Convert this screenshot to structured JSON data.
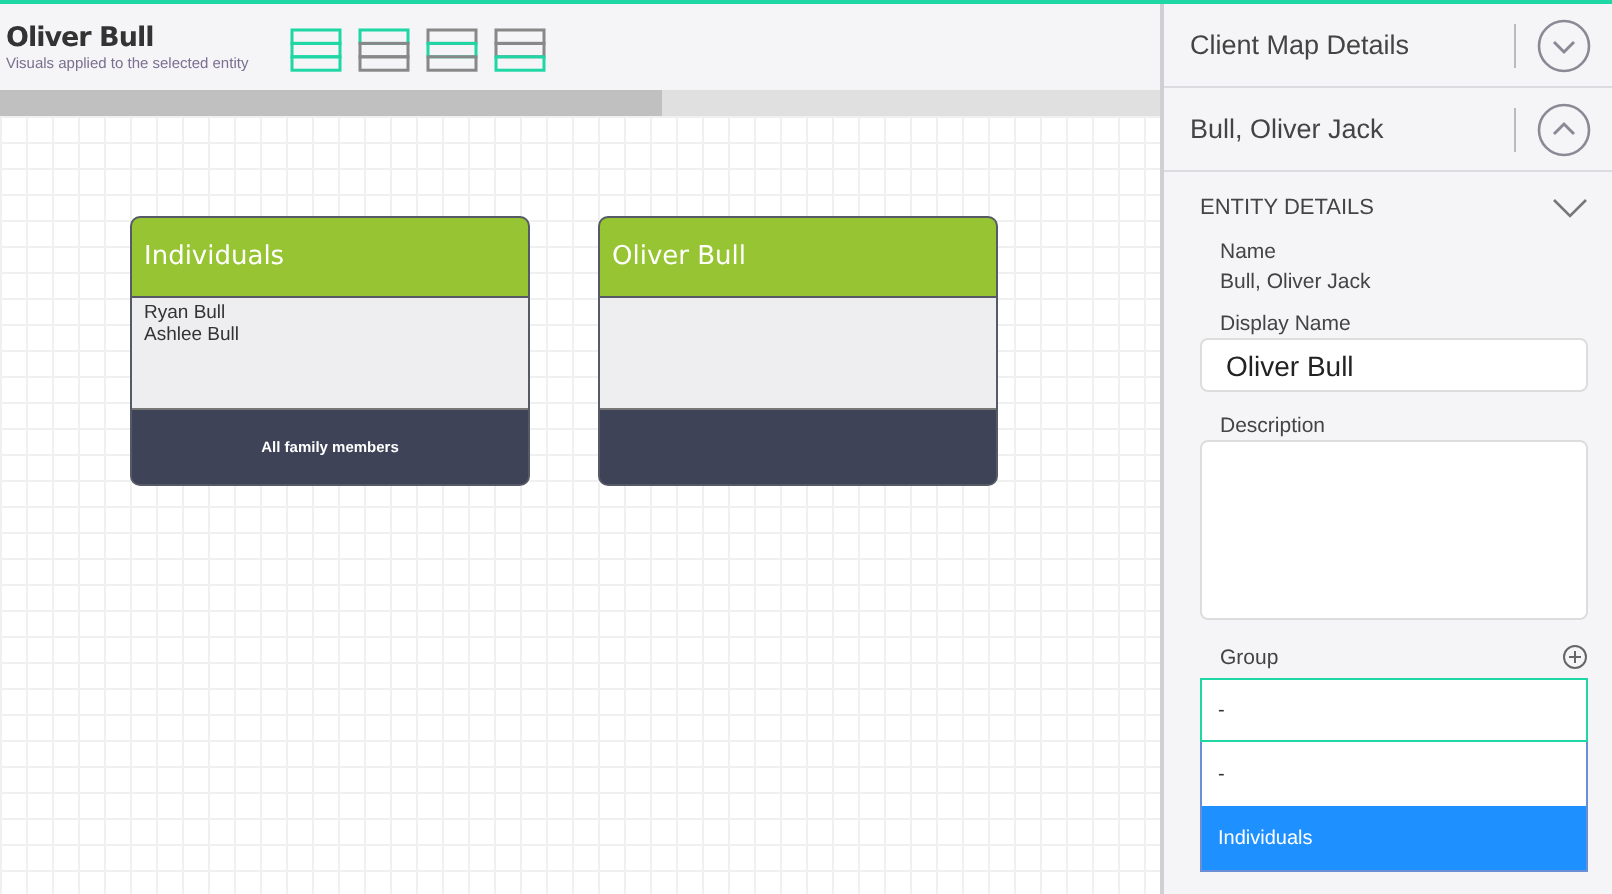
{
  "header": {
    "title": "Oliver Bull",
    "subtitle": "Visuals applied to the selected entity"
  },
  "layouts": [
    {
      "kind": "all"
    },
    {
      "kind": "top"
    },
    {
      "kind": "middle"
    },
    {
      "kind": "bottom"
    }
  ],
  "scrollbar": {
    "level": 0.57
  },
  "cards": [
    {
      "title": "Individuals",
      "members": [
        "Ryan Bull",
        "Ashlee Bull"
      ],
      "footer": "All family members"
    },
    {
      "title": "Oliver Bull"
    }
  ],
  "sections": [
    {
      "title": "Client Map Details",
      "expanded": false
    },
    {
      "title": "Bull, Oliver Jack",
      "expanded": true
    }
  ],
  "entity_details": {
    "heading": "ENTITY DETAILS",
    "expanded": true,
    "name_label": "Name",
    "name_value": "Bull, Oliver Jack",
    "display_name_label": "Display Name",
    "display_name": "Oliver Bull",
    "description_label": "Description",
    "group_label": "Group",
    "group_value": "-",
    "group_options": [
      {
        "label": "-",
        "selected": false
      },
      {
        "label": "Individuals",
        "selected": true
      }
    ]
  }
}
